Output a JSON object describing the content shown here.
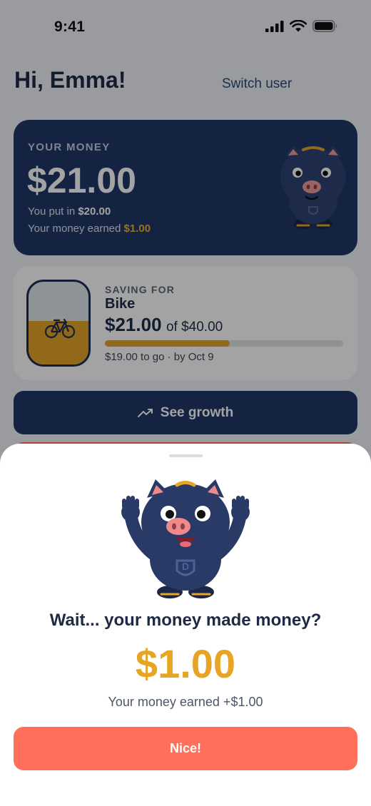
{
  "status_bar": {
    "time": "9:41"
  },
  "header": {
    "greeting": "Hi, Emma!",
    "switch_user": "Switch user"
  },
  "money_card": {
    "label": "YOUR MONEY",
    "amount": "$21.00",
    "put_in_prefix": "You put in ",
    "put_in_value": "$20.00",
    "earned_prefix": "Your money earned ",
    "earned_value": "$1.00"
  },
  "goal_card": {
    "tag": "SAVING FOR",
    "name": "Bike",
    "saved": "$21.00",
    "target": "of $40.00",
    "remaining": "$19.00 to go · by Oct 9",
    "progress": 0.525
  },
  "buttons": {
    "see_growth": "See growth"
  },
  "sheet": {
    "title": "Wait... your money made money?",
    "amount": "$1.00",
    "subtitle": "Your money earned +$1.00",
    "cta": "Nice!"
  },
  "colors": {
    "navy": "#22386a",
    "gold": "#e8a423",
    "coral": "#ff6f59",
    "pig_body": "#2a3a66",
    "pig_snout": "#f08a8a"
  }
}
